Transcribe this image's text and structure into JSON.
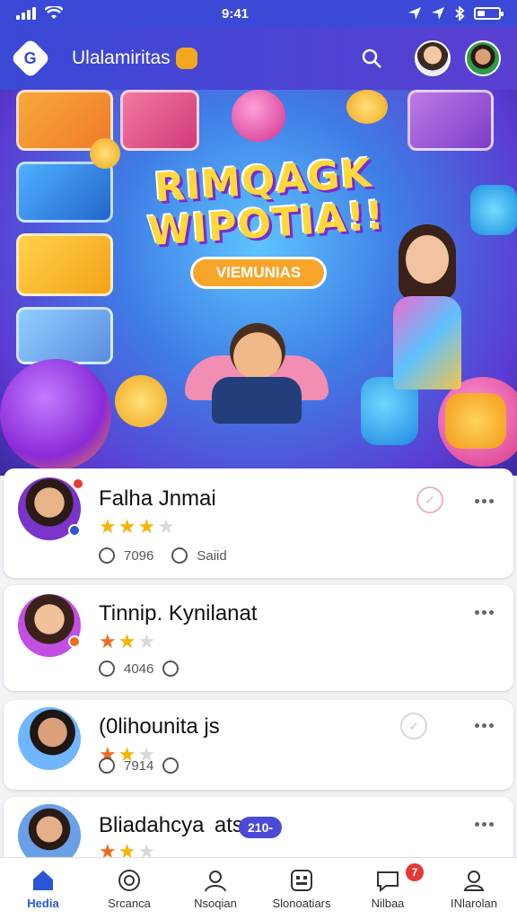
{
  "status_bar": {
    "time": "9:41",
    "icons": [
      "signal-icon",
      "wifi-icon",
      "location-icon",
      "bluetooth-icon",
      "battery-icon"
    ]
  },
  "app_bar": {
    "title": "Ulalamiritas",
    "icons": [
      "app-logo-icon",
      "search-icon"
    ]
  },
  "hero": {
    "title_line1": "RIMQAGK",
    "title_line2": "WIPOTIA!!",
    "tag": "VIEMUNIAS"
  },
  "cards": [
    {
      "name": "Falha Jnmai",
      "rating": 3,
      "stat1": "7096",
      "stat2": "Saiid",
      "star_color": "#f4b400"
    },
    {
      "name": "Tinnip. Kynilanat",
      "rating": 2,
      "stat1": "4046",
      "stat2": "",
      "star_color": "#f06a1d"
    },
    {
      "name": "(0lihounita js",
      "rating": 2,
      "stat1": "7914",
      "stat2": "",
      "star_color": "#f06a1d"
    },
    {
      "name": "Bliadahcya  ats",
      "rating": 2,
      "badge": "210-",
      "star_color": "#f06a1d"
    }
  ],
  "bottom_nav": {
    "items": [
      "Hedia",
      "Srcanca",
      "Nsoqian",
      "Slonoatiars",
      "Nilbaa",
      "INlarolan"
    ],
    "active_index": 0,
    "notification_badge": "7"
  },
  "colors": {
    "brand": "#3a49d6",
    "accent": "#2a55d6",
    "star": "#f4b400",
    "badge": "#e53935"
  }
}
